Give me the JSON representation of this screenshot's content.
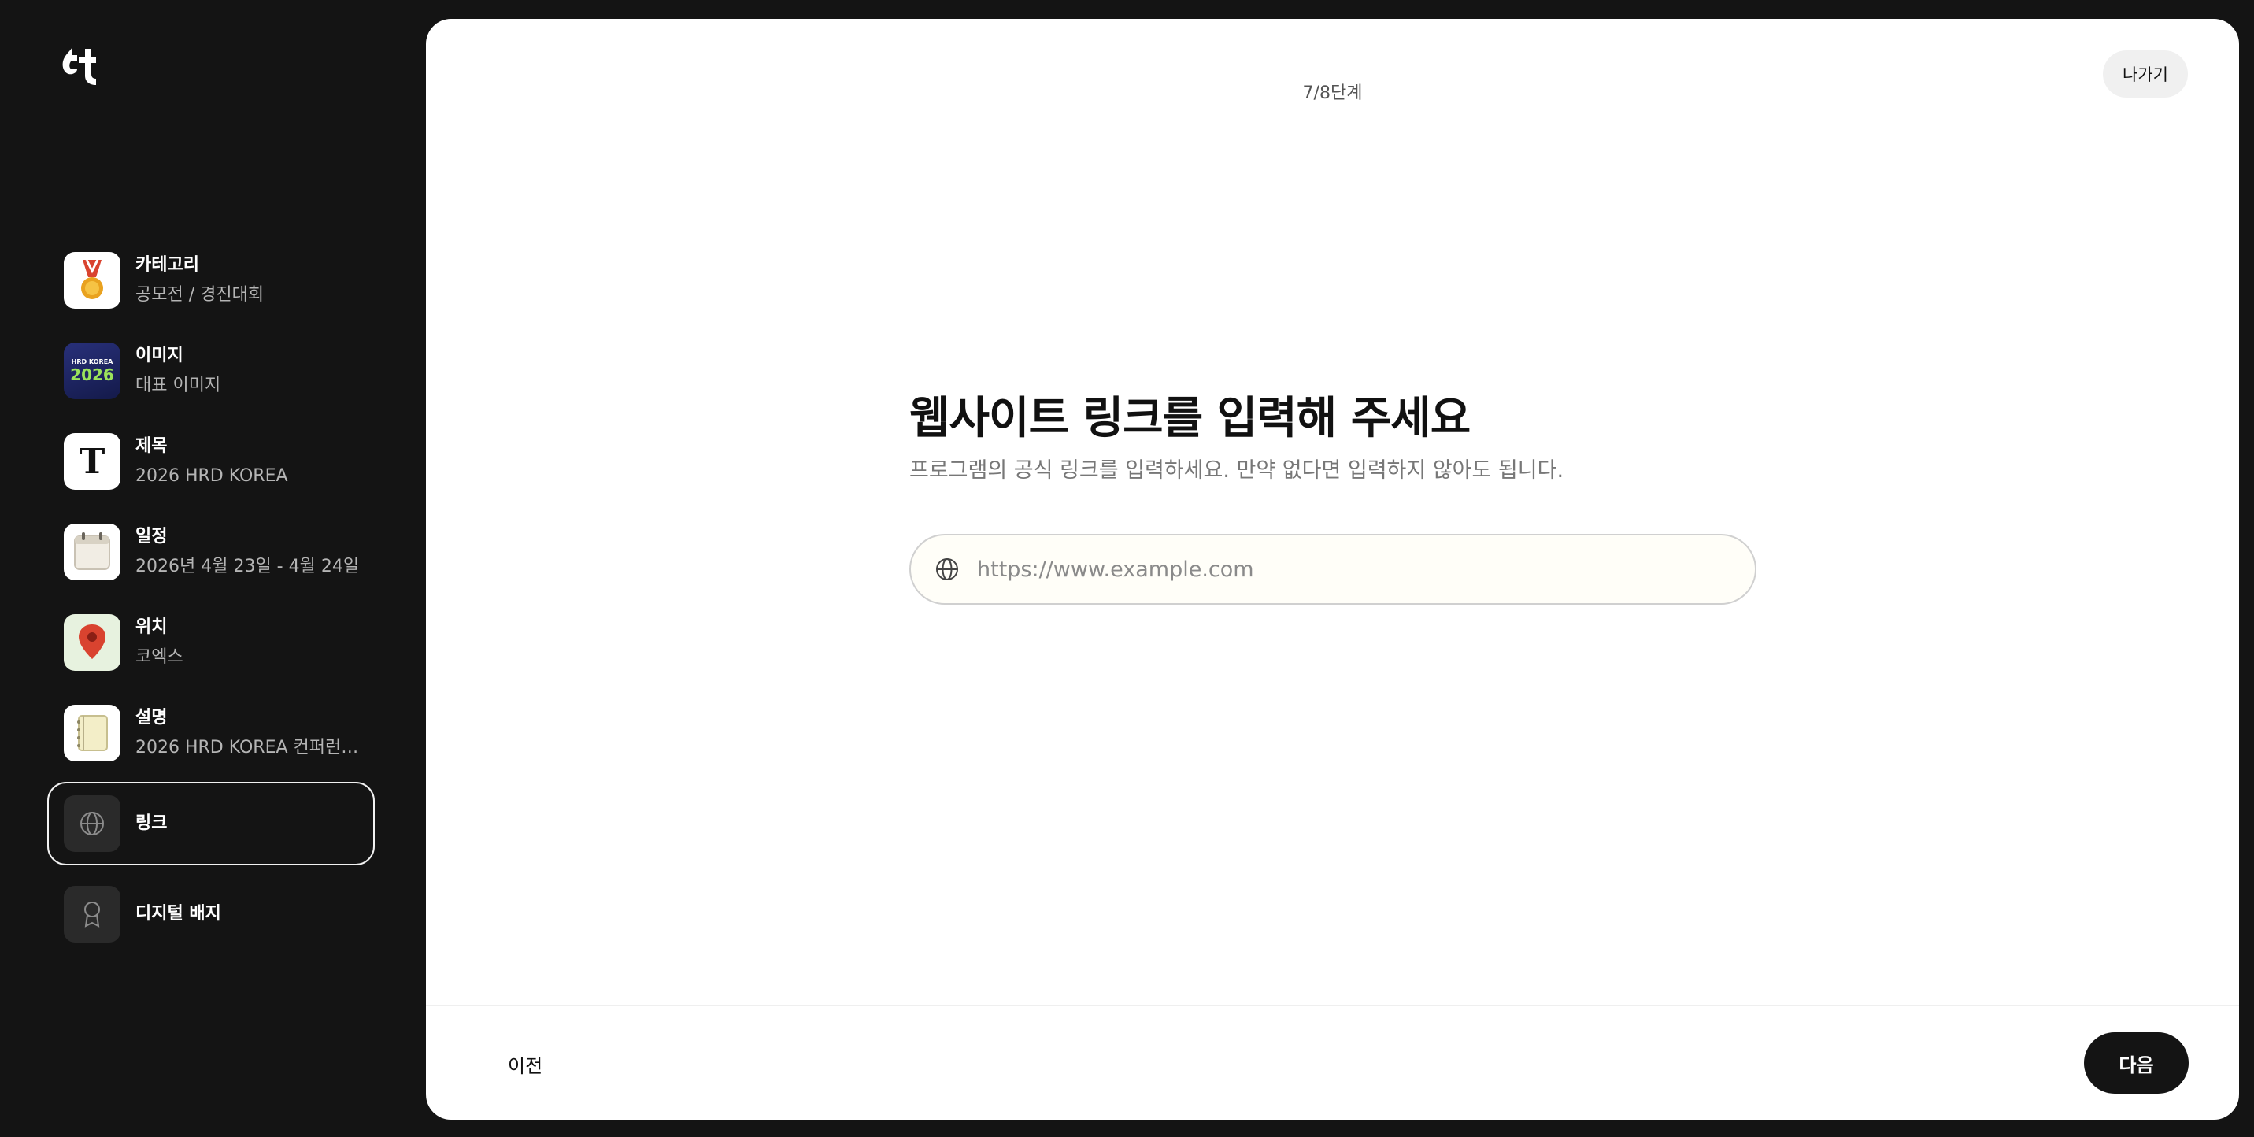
{
  "sidebar": {
    "logo": "tt-logo",
    "items": [
      {
        "label": "카테고리",
        "value": "공모전 / 경진대회",
        "icon": "medal-icon"
      },
      {
        "label": "이미지",
        "value": "대표 이미지",
        "icon": "poster-thumbnail",
        "thumb_text": {
          "line1": "HRD KOREA",
          "line2": "2026"
        }
      },
      {
        "label": "제목",
        "value": "2026 HRD KOREA",
        "icon": "title-t-icon",
        "glyph": "T"
      },
      {
        "label": "일정",
        "value": "2026년 4월 23일 - 4월 24일",
        "icon": "calendar-icon"
      },
      {
        "label": "위치",
        "value": "코엑스",
        "icon": "map-pin-icon"
      },
      {
        "label": "설명",
        "value": "2026 HRD KOREA 컨퍼런스...",
        "icon": "notepad-icon"
      },
      {
        "label": "링크",
        "value": "",
        "icon": "globe-icon",
        "active": true
      },
      {
        "label": "디지털 배지",
        "value": "",
        "icon": "badge-icon"
      }
    ]
  },
  "header": {
    "step_counter": "7/8단계",
    "exit_label": "나가기"
  },
  "main": {
    "heading": "웹사이트 링크를 입력해 주세요",
    "subtext": "프로그램의 공식 링크를 입력하세요. 만약 없다면 입력하지 않아도 됩니다.",
    "url_input": {
      "placeholder": "https://www.example.com",
      "value": ""
    }
  },
  "footer": {
    "prev_label": "이전",
    "next_label": "다음"
  },
  "colors": {
    "background": "#141414",
    "card": "#ffffff",
    "accent": "#141414",
    "input_bg": "#fffef8"
  }
}
